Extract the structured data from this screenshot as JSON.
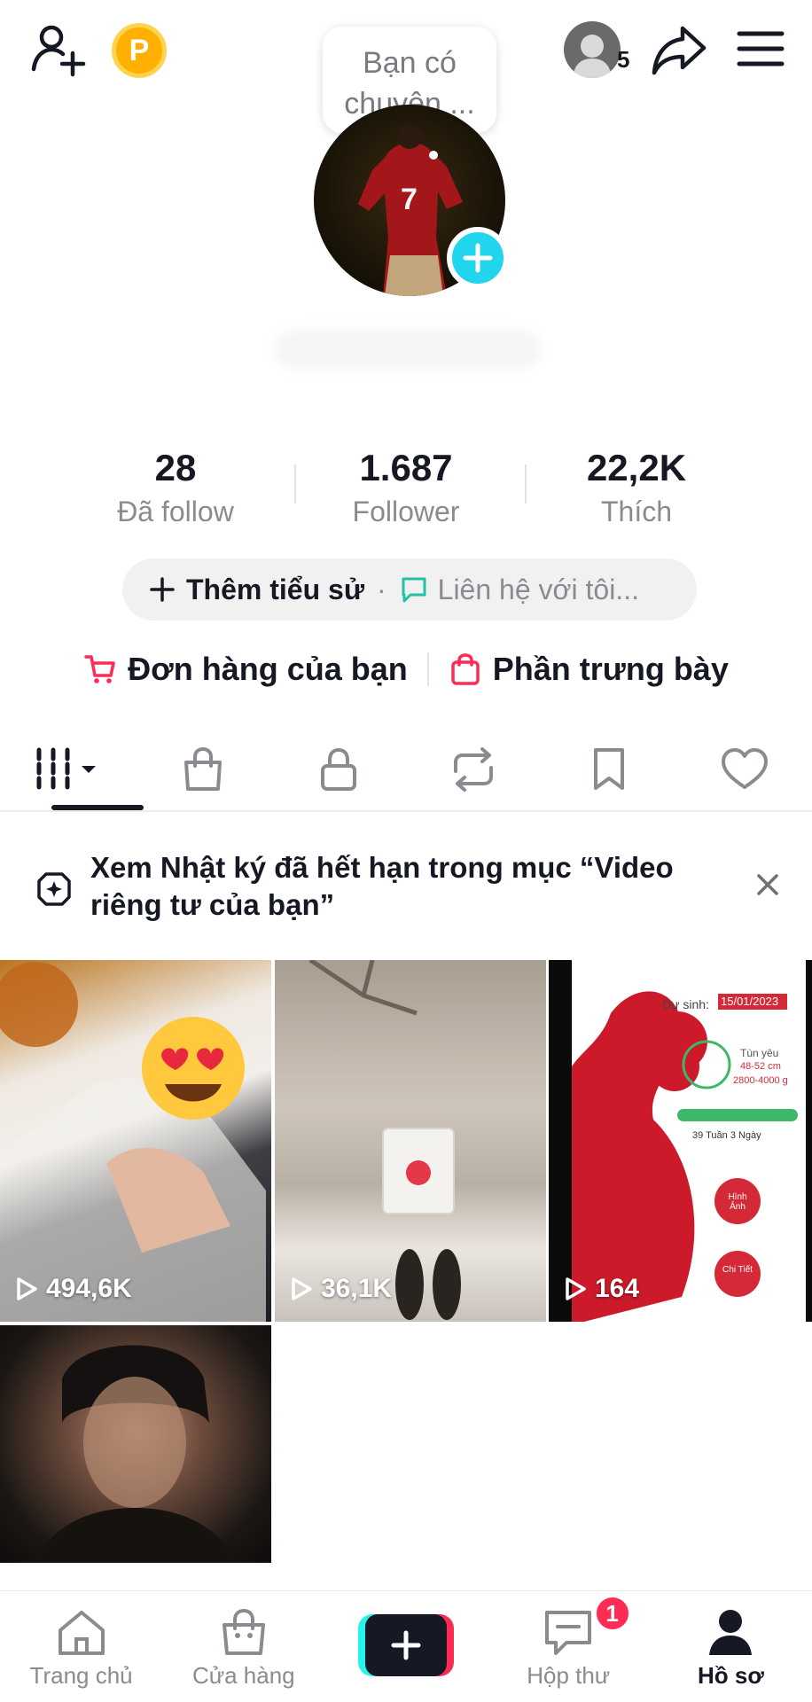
{
  "header": {
    "note_text": "Bạn có chuyện ...",
    "story_count": "5",
    "coin_letter": "P"
  },
  "stats": [
    {
      "value": "28",
      "label": "Đã follow"
    },
    {
      "value": "1.687",
      "label": "Follower"
    },
    {
      "value": "22,2K",
      "label": "Thích"
    }
  ],
  "bio": {
    "add_label": "Thêm tiểu sử",
    "separator": "·",
    "contact_label": "Liên hệ với tôi..."
  },
  "shop": {
    "orders_label": "Đơn hàng của bạn",
    "showcase_label": "Phần trưng bày"
  },
  "tabs": [
    "videos-grid",
    "shop",
    "private",
    "reposts",
    "favorites",
    "liked"
  ],
  "notice": {
    "text": "Xem Nhật ký đã hết hạn trong mục “Video riêng tư của bạn”"
  },
  "videos": [
    {
      "views": "494,6K"
    },
    {
      "views": "36,1K"
    },
    {
      "views": "164"
    },
    {
      "views": ""
    }
  ],
  "video3_overlay": {
    "due_label": "Dự sinh:",
    "due_date": "15/01/2023",
    "age_label": "Tùn yêu",
    "size": "48-52 cm",
    "weight": "2800-4000 g",
    "weeks": "39 Tuần 3 Ngày",
    "btn1": "Hình Ảnh",
    "btn2": "Chi Tiết"
  },
  "bottom_nav": {
    "home": "Trang chủ",
    "shop": "Cửa hàng",
    "inbox": "Hộp thư",
    "inbox_badge": "1",
    "profile": "Hồ sơ"
  },
  "colors": {
    "accent_red": "#FE2C55",
    "accent_cyan": "#25F4EE",
    "text_primary": "#161823",
    "text_secondary": "#8a8b91"
  }
}
